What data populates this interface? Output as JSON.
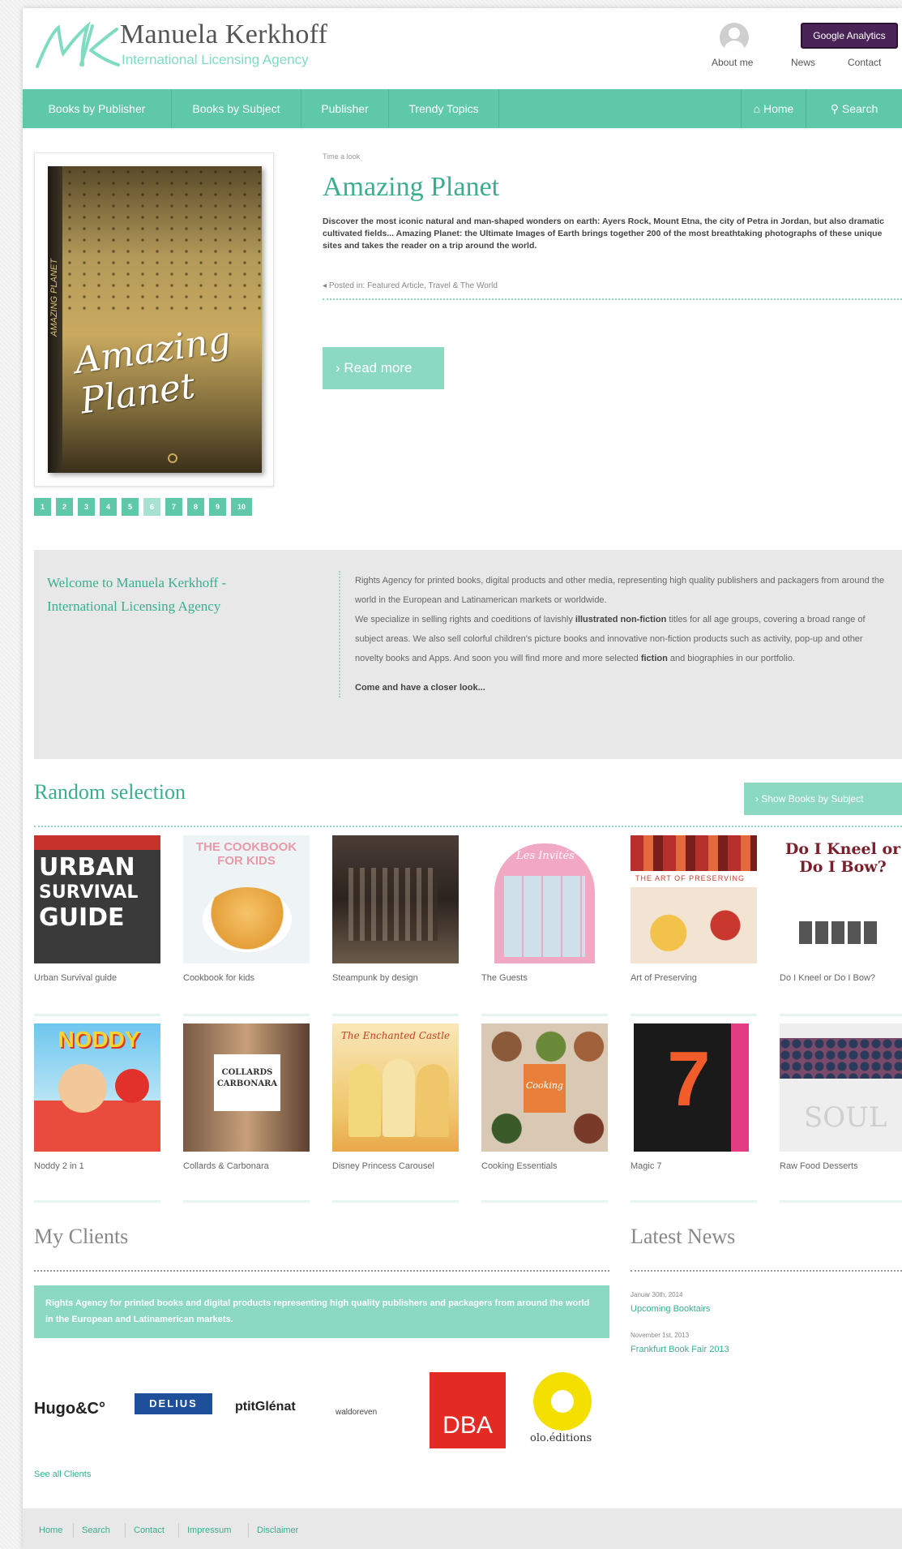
{
  "header": {
    "brand_name": "Manuela Kerkhoff",
    "brand_sub": "International Licensing Agency",
    "about": "About me",
    "news": "News",
    "contact": "Contact",
    "ga_button": "Google Analytics"
  },
  "nav": {
    "items": [
      "Books by Publisher",
      "Books by Subject",
      "Publisher",
      "Trendy Topics"
    ],
    "home": "Home",
    "search": "Search"
  },
  "feature": {
    "crumb": "Time a look",
    "title": "Amazing Planet",
    "description": "Discover the most iconic natural and man-shaped wonders on earth: Ayers Rock, Mount Etna, the city of Petra in Jordan, but also dramatic cultivated fields... Amazing Planet: the Ultimate Images of Earth brings together 200 of the most breathtaking photographs of these unique sites and takes the reader on a trip around the world.",
    "posted": "Posted in: Featured Article, Travel & The World",
    "read_more": "Read more",
    "cover_title": "Amazing Planet",
    "cover_spine": "AMAZING PLANET",
    "pages": [
      "1",
      "2",
      "3",
      "4",
      "5",
      "6",
      "7",
      "8",
      "9",
      "10"
    ],
    "active_page": 6
  },
  "welcome": {
    "title": "Welcome to Manuela Kerkhoff - International Licensing Agency",
    "p1": "Rights Agency for printed books, digital products and other media, representing high quality publishers and packagers from around the world in the European and Latinamerican markets or worldwide.",
    "p2a": "We specialize in selling rights and coeditions of lavishly ",
    "p2b": "illustrated non-fiction",
    "p2c": " titles for all age groups, covering a broad range of subject areas. We also sell colorful children's picture books and innovative non-fiction products such as activity, pop-up and other novelty books and Apps. And soon you will find more and more selected ",
    "p2d": "fiction",
    "p2e": " and biographies in our portfolio.",
    "cta": "Come and have a closer look..."
  },
  "random": {
    "title": "Random selection",
    "show_button": "Show Books by Subject",
    "books": [
      "Urban Survival guide",
      "Cookbook for kids",
      "Steampunk by design",
      "The Guests",
      "Art of Preserving",
      "Do I Kneel or Do I Bow?",
      "Noddy 2 in 1",
      "Collards & Carbonara",
      "Disney Princess Carousel",
      "Cooking Essentials",
      "Magic 7",
      "Raw Food Desserts"
    ],
    "cover_texts": {
      "urban": [
        "URBAN",
        "SURVIVAL",
        "GUIDE"
      ],
      "cookbook": "THE COOKBOOK FOR KIDS",
      "guests": "Les Invités",
      "preserving": "THE ART OF PRESERVING",
      "kneel": "Do I Kneel or Do I Bow?",
      "noddy": "NODDY",
      "collards": "COLLARDS CARBONARA",
      "disney": "The Enchanted Castle",
      "cooking": "Cooking",
      "magic": "7",
      "raw": "SOUL"
    }
  },
  "clients": {
    "title": "My Clients",
    "bar_text": "Rights Agency for printed books and digital products representing high quality publishers and packagers from around the world in the European and Latinamerican markets.",
    "logos": [
      "Hugo&C°",
      "DELIUS",
      "ptitGlénat",
      "waldoreven",
      "DBA",
      "olo.éditions"
    ],
    "see_all": "See all Clients"
  },
  "news": {
    "title": "Latest News",
    "items": [
      {
        "date": "Januar 30th, 2014",
        "title": "Upcoming Booktairs"
      },
      {
        "date": "November 1st, 2013",
        "title": "Frankfurt Book Fair 2013"
      }
    ]
  },
  "footer": {
    "links": [
      "Home",
      "Search",
      "Contact",
      "Impressum",
      "Disclaimer"
    ]
  },
  "colors": {
    "accent": "#5fc8a9",
    "accent_light": "#8ad9c0",
    "ga_purple": "#4a2456"
  }
}
